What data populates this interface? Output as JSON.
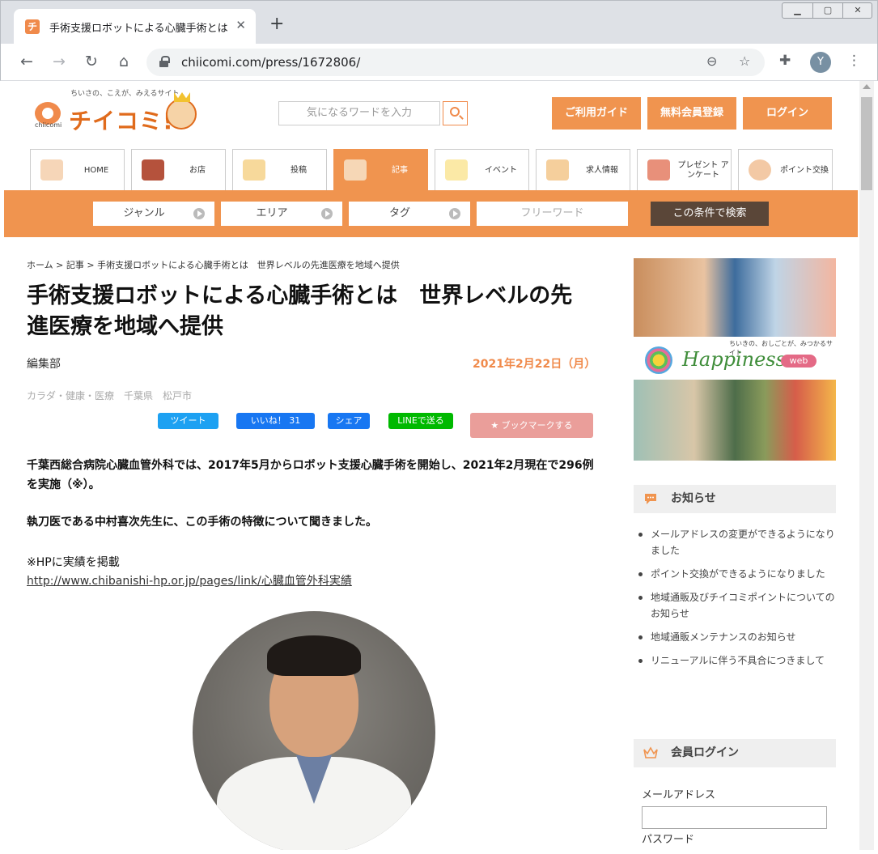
{
  "browser": {
    "tab_title": "手術支援ロボットによる心臓手術とは",
    "tab_favicon": "チ",
    "url": "chiicomi.com/press/1672806/",
    "profile_initial": "Y"
  },
  "site": {
    "logo_tagline": "ちいさの、こえが、みえるサイト",
    "logo_sub": "chiicomi",
    "logo_text": "チイコミ!",
    "search_placeholder": "気になるワードを入力",
    "header_buttons": [
      "ご利用ガイド",
      "無料会員登録",
      "ログイン"
    ]
  },
  "nav": {
    "tabs": [
      {
        "label": "HOME",
        "icon": "house-icon"
      },
      {
        "label": "お店",
        "icon": "shop-icon"
      },
      {
        "label": "投稿",
        "icon": "pencil-bubble-icon"
      },
      {
        "label": "記事",
        "icon": "newspaper-icon"
      },
      {
        "label": "イベント",
        "icon": "stars-icon"
      },
      {
        "label": "求人情報",
        "icon": "person-magnifier-icon"
      },
      {
        "label": "プレゼント アンケート",
        "icon": "gift-icon"
      },
      {
        "label": "ポイント交換",
        "icon": "point-coin-icon"
      }
    ],
    "active_index": 3
  },
  "filter": {
    "genre": "ジャンル",
    "area": "エリア",
    "tag": "タグ",
    "freeword_placeholder": "フリーワード",
    "submit": "この条件で検索"
  },
  "article": {
    "breadcrumb": "ホーム > 記事 > 手術支援ロボットによる心臓手術とは　世界レベルの先進医療を地域へ提供",
    "title": "手術支援ロボットによる心臓手術とは　世界レベルの先進医療を地域へ提供",
    "author": "編集部",
    "date": "2021年2月22日（月）",
    "categories": "カラダ・健康・医療　千葉県　松戸市",
    "share": {
      "tweet": "ツイート",
      "like": "いいね！ 31",
      "share": "シェア",
      "line": "LINEで送る",
      "bookmark": "★ ブックマークする"
    },
    "para1": "千葉西総合病院心臓血管外科では、2017年5月からロボット支援心臓手術を開始し、2021年2月現在で296例を実施（※）。",
    "para2": "執刀医である中村喜次先生に、この手術の特徴について聞きました。",
    "note": "※HPに実績を掲載",
    "link": "http://www.chibanishi-hp.or.jp/pages/link/心臓血管外科実績"
  },
  "sidebar": {
    "ad": {
      "tagline": "ちいきの、おしごとが、みつかるサイト",
      "brand": "Happiness",
      "web": "web"
    },
    "news_title": "お知らせ",
    "news": [
      "メールアドレスの変更ができるようになりました",
      "ポイント交換ができるようになりました",
      "地域通販及びチイコミポイントについてのお知らせ",
      "地域通販メンテナンスのお知らせ",
      "リニューアルに伴う不具合につきまして"
    ],
    "login_title": "会員ログイン",
    "email_label": "メールアドレス",
    "password_label": "パスワード"
  },
  "colors": {
    "accent": "#f0944f",
    "dark_button": "#5a4638",
    "date": "#f08a4b"
  }
}
